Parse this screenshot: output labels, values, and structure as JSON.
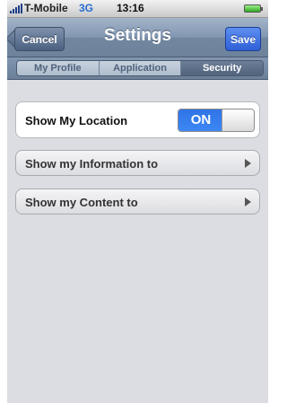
{
  "status_bar": {
    "carrier": "T-Mobile",
    "network": "3G",
    "time": "13:16",
    "signal_icon": "signal-bars-icon",
    "battery_icon": "battery-icon"
  },
  "nav": {
    "title": "Settings",
    "cancel_label": "Cancel",
    "save_label": "Save"
  },
  "tabs": [
    {
      "label": "My Profile",
      "active": false
    },
    {
      "label": "Application",
      "active": false
    },
    {
      "label": "Security",
      "active": true
    }
  ],
  "settings": {
    "show_location": {
      "label": "Show My Location",
      "toggle_text": "ON",
      "value": true
    },
    "show_information": {
      "label": "Show my Information to",
      "icon": "chevron-right-icon"
    },
    "show_content": {
      "label": "Show my Content to",
      "icon": "chevron-right-icon"
    }
  },
  "colors": {
    "nav_bar": "#8196b1",
    "save_button": "#2e60d6",
    "toggle_on": "#2f74e6",
    "network_text": "#2a6fcf",
    "background": "#dcdde2"
  }
}
